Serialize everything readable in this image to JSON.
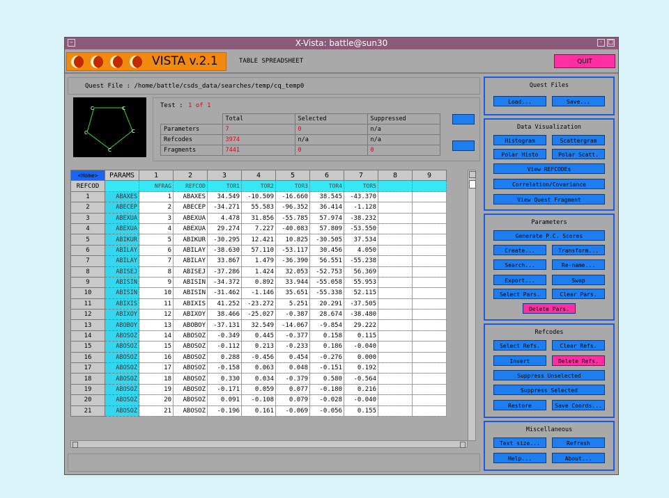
{
  "window": {
    "title": "X-Vista: battle@sun30"
  },
  "app": {
    "title": "VISTA v.2.1",
    "view_label": "TABLE SPREADSHEET",
    "quit_label": "QUIT"
  },
  "query_file": {
    "label": "Quest File :",
    "path": "/home/battle/csds_data/searches/temp/cq_temp0"
  },
  "test": {
    "label": "Test :",
    "value": "1 of 1"
  },
  "stats": {
    "columns": [
      "",
      "Total",
      "Selected",
      "Suppressed"
    ],
    "rows": [
      {
        "name": "Parameters",
        "total": "7",
        "selected": "0",
        "suppressed": "n/a"
      },
      {
        "name": "Refcodes",
        "total": "3974",
        "selected": "n/a",
        "suppressed": "n/a"
      },
      {
        "name": "Fragments",
        "total": "7441",
        "selected": "0",
        "suppressed": "0"
      }
    ]
  },
  "grid": {
    "home_label": "<Home>",
    "params_label": "PARAMS",
    "refcod_label": "REFCOD",
    "col_numbers": [
      "1",
      "2",
      "3",
      "4",
      "5",
      "6",
      "7",
      "8",
      "9"
    ],
    "param_names": [
      "NFRAG",
      "REFCOD",
      "TOR1",
      "TOR2",
      "TOR3",
      "TOR4",
      "TOR5"
    ],
    "rows": [
      {
        "n": "1",
        "p": "ABAXES",
        "c": [
          "1",
          "ABAXES",
          "34.549",
          "-10.509",
          "-16.660",
          "38.545",
          "-43.370"
        ]
      },
      {
        "n": "2",
        "p": "ABECEP",
        "c": [
          "2",
          "ABECEP",
          "-34.271",
          "55.583",
          "-96.352",
          "36.414",
          "-1.128"
        ]
      },
      {
        "n": "3",
        "p": "ABEXUA",
        "c": [
          "3",
          "ABEXUA",
          "4.478",
          "31.856",
          "-55.785",
          "57.974",
          "-38.232"
        ]
      },
      {
        "n": "4",
        "p": "ABEXUA",
        "c": [
          "4",
          "ABEXUA",
          "29.274",
          "7.227",
          "-40.083",
          "57.809",
          "-53.550"
        ]
      },
      {
        "n": "5",
        "p": "ABIKUR",
        "c": [
          "5",
          "ABIKUR",
          "-30.295",
          "12.421",
          "10.825",
          "-30.505",
          "37.534"
        ]
      },
      {
        "n": "6",
        "p": "ABILAY",
        "c": [
          "6",
          "ABILAY",
          "-38.630",
          "57.110",
          "-53.117",
          "30.456",
          "4.050"
        ]
      },
      {
        "n": "7",
        "p": "ABILAY",
        "c": [
          "7",
          "ABILAY",
          "33.867",
          "1.479",
          "-36.390",
          "56.551",
          "-55.238"
        ]
      },
      {
        "n": "8",
        "p": "ABISEJ",
        "c": [
          "8",
          "ABISEJ",
          "-37.286",
          "1.424",
          "32.053",
          "-52.753",
          "56.369"
        ]
      },
      {
        "n": "9",
        "p": "ABISIN",
        "c": [
          "9",
          "ABISIN",
          "-34.372",
          "0.892",
          "33.944",
          "-55.058",
          "55.953"
        ]
      },
      {
        "n": "10",
        "p": "ABISIN",
        "c": [
          "10",
          "ABISIN",
          "-31.462",
          "-1.146",
          "35.651",
          "-55.338",
          "52.115"
        ]
      },
      {
        "n": "11",
        "p": "ABIXIS",
        "c": [
          "11",
          "ABIXIS",
          "41.252",
          "-23.272",
          "5.251",
          "20.291",
          "-37.505"
        ]
      },
      {
        "n": "12",
        "p": "ABIXOY",
        "c": [
          "12",
          "ABIXOY",
          "38.466",
          "-25.027",
          "-0.387",
          "28.674",
          "-38.480"
        ]
      },
      {
        "n": "13",
        "p": "ABOBOY",
        "c": [
          "13",
          "ABOBOY",
          "-37.131",
          "32.549",
          "-14.067",
          "-9.854",
          "29.222"
        ]
      },
      {
        "n": "14",
        "p": "ABOSOZ",
        "c": [
          "14",
          "ABOSOZ",
          "-0.349",
          "0.445",
          "-0.377",
          "0.158",
          "0.115"
        ]
      },
      {
        "n": "15",
        "p": "ABOSOZ",
        "c": [
          "15",
          "ABOSOZ",
          "-0.112",
          "0.213",
          "-0.233",
          "0.186",
          "-0.040"
        ]
      },
      {
        "n": "16",
        "p": "ABOSOZ",
        "c": [
          "16",
          "ABOSOZ",
          "0.288",
          "-0.456",
          "0.454",
          "-0.276",
          "0.000"
        ]
      },
      {
        "n": "17",
        "p": "ABOSOZ",
        "c": [
          "17",
          "ABOSOZ",
          "-0.158",
          "0.063",
          "0.048",
          "-0.151",
          "0.192"
        ]
      },
      {
        "n": "18",
        "p": "ABOSOZ",
        "c": [
          "18",
          "ABOSOZ",
          "0.330",
          "0.034",
          "-0.379",
          "0.580",
          "-0.564"
        ]
      },
      {
        "n": "19",
        "p": "ABOSOZ",
        "c": [
          "19",
          "ABOSOZ",
          "-0.171",
          "0.059",
          "0.077",
          "-0.180",
          "0.216"
        ]
      },
      {
        "n": "20",
        "p": "ABOSOZ",
        "c": [
          "20",
          "ABOSOZ",
          "0.091",
          "-0.108",
          "0.079",
          "-0.028",
          "-0.040"
        ]
      },
      {
        "n": "21",
        "p": "ABOSOZ",
        "c": [
          "21",
          "ABOSOZ",
          "-0.196",
          "0.161",
          "-0.069",
          "-0.056",
          "0.155"
        ]
      }
    ]
  },
  "panels": {
    "quest_files": {
      "title": "Quest Files",
      "load": "Load...",
      "save": "Save..."
    },
    "data_viz": {
      "title": "Data Visualization",
      "histogram": "Histogram",
      "scattergram": "Scattergram",
      "polar_histo": "Polar Histo",
      "polar_scatt": "Polar Scatt.",
      "view_refcodes": "View REFCODEs",
      "correlation": "Correlation/Covariance",
      "view_fragment": "View Quest Fragment"
    },
    "parameters": {
      "title": "Parameters",
      "generate_pc": "Generate P.C. Scores",
      "create": "Create...",
      "transform": "Transform...",
      "search": "Search...",
      "rename": "Re-name...",
      "export": "Export...",
      "swap": "Swap",
      "select_pars": "Select Pars.",
      "clear_pars": "Clear Pars.",
      "delete_pars": "Delete Pars."
    },
    "refcodes": {
      "title": "Refcodes",
      "select_refs": "Select Refs.",
      "clear_refs": "Clear Refs.",
      "invert": "Invert",
      "delete_refs": "Delete Refs.",
      "suppress_unselected": "Suppress Unselected",
      "suppress_selected": "Suppress Selected",
      "restore": "Restore",
      "save_coords": "Save Coords..."
    },
    "misc": {
      "title": "Miscellaneous",
      "text_size": "Text size...",
      "refresh": "Refresh",
      "help": "Help...",
      "about": "About..."
    }
  }
}
